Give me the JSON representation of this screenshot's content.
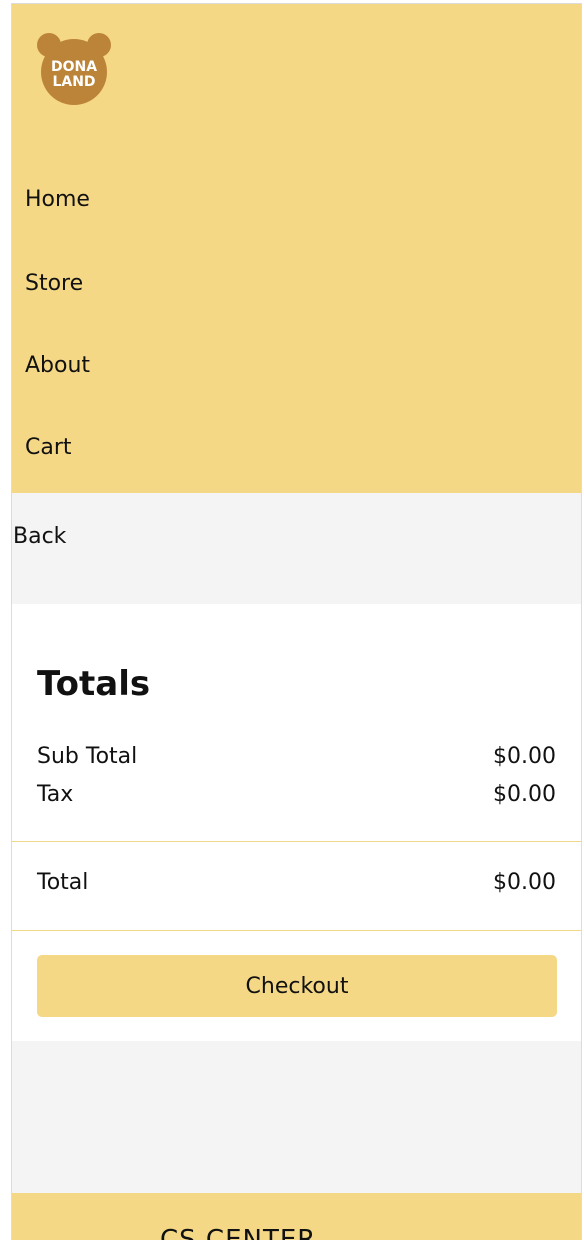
{
  "brand": {
    "logo_text_line1": "DONA",
    "logo_text_line2": "LAND",
    "logo_color": "#bc8438",
    "accent_color": "#f5d886"
  },
  "nav": {
    "items": [
      {
        "label": "Home"
      },
      {
        "label": "Store"
      },
      {
        "label": "About"
      },
      {
        "label": "Cart"
      }
    ]
  },
  "back_label": "Back",
  "totals": {
    "title": "Totals",
    "subtotal_label": "Sub Total",
    "subtotal_value": "$0.00",
    "tax_label": "Tax",
    "tax_value": "$0.00",
    "total_label": "Total",
    "total_value": "$0.00",
    "checkout_label": "Checkout"
  },
  "footer": {
    "title": "CS CENTER"
  }
}
